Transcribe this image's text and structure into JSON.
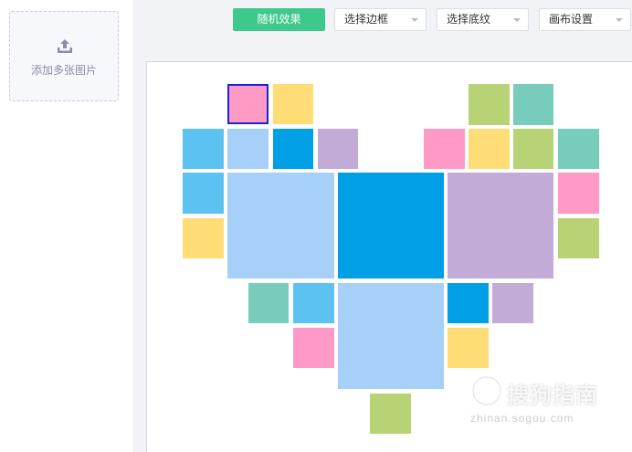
{
  "sidebar": {
    "upload_label": "添加多张图片",
    "upload_icon": "upload-icon"
  },
  "toolbar": {
    "random_label": "随机效果",
    "border_select": "选择边框",
    "texture_select": "选择底纹",
    "canvas_select": "画布设置"
  },
  "colors": {
    "accent": "#3ec98c",
    "selection": "#1a24d6"
  },
  "collage": {
    "tiles": [
      {
        "color": "#fe9ac5",
        "selected": true
      },
      {
        "color": "#fedd76",
        "selected": false
      },
      {
        "color": "#b7d376",
        "selected": false
      },
      {
        "color": "#77ccbc",
        "selected": false
      },
      {
        "color": "#5bc2f2",
        "selected": false
      },
      {
        "color": "#a6d0f8",
        "selected": false
      },
      {
        "color": "#009fe6",
        "selected": false
      },
      {
        "color": "#c2acd7",
        "selected": false
      },
      {
        "color": "#fe9ac5",
        "selected": false
      },
      {
        "color": "#fedd76",
        "selected": false
      },
      {
        "color": "#b7d376",
        "selected": false
      },
      {
        "color": "#77ccbc",
        "selected": false
      },
      {
        "color": "#5bc2f2",
        "selected": false
      },
      {
        "color": "#fedd76",
        "selected": false
      },
      {
        "color": "#a6d0f8",
        "selected": false
      },
      {
        "color": "#009fe6",
        "selected": false
      },
      {
        "color": "#c2acd7",
        "selected": false
      },
      {
        "color": "#fe9ac5",
        "selected": false
      },
      {
        "color": "#b7d376",
        "selected": false
      },
      {
        "color": "#77ccbc",
        "selected": false
      },
      {
        "color": "#5bc2f2",
        "selected": false
      },
      {
        "color": "#fe9ac5",
        "selected": false
      },
      {
        "color": "#a6d0f8",
        "selected": false
      },
      {
        "color": "#009fe6",
        "selected": false
      },
      {
        "color": "#c2acd7",
        "selected": false
      },
      {
        "color": "#fedd76",
        "selected": false
      },
      {
        "color": "#b7d376",
        "selected": false
      }
    ]
  },
  "watermark": {
    "text": "搜狗指南",
    "url": "zhinan.sogou.com"
  }
}
